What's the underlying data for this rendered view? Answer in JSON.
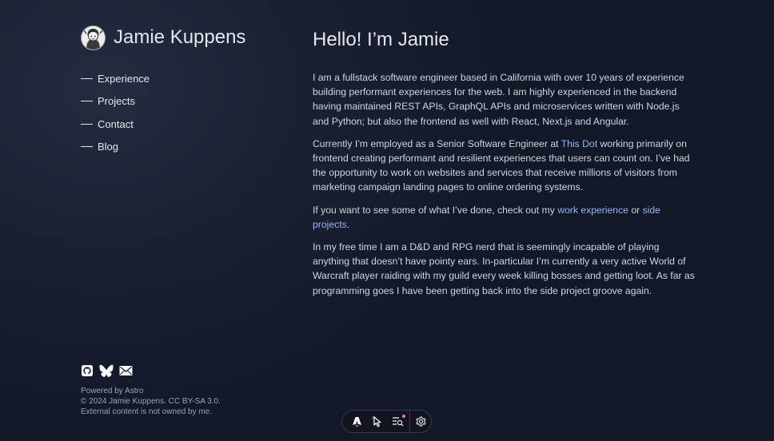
{
  "sidebar": {
    "site_name": "Jamie Kuppens",
    "avatar_icon": "avatar-illustration",
    "nav": [
      {
        "label": "Experience"
      },
      {
        "label": "Projects"
      },
      {
        "label": "Contact"
      },
      {
        "label": "Blog"
      }
    ],
    "social": [
      {
        "icon": "github-icon"
      },
      {
        "icon": "bluesky-icon"
      },
      {
        "icon": "mail-icon"
      }
    ],
    "footer": {
      "powered": "Powered by Astro",
      "copyright": "© 2024 Jamie Kuppens. CC BY-SA 3.0.",
      "disclaimer": "External content is not owned by me."
    }
  },
  "main": {
    "title": "Hello! I’m Jamie",
    "p1": "I am a fullstack software engineer based in California with over 10 years of experience building performant experiences for the web. I am highly experienced in the backend having maintained REST APIs, GraphQL APIs and microservices written with Node.js and Python; but also the frontend as well with React, Next.js and Angular.",
    "p2_before": "Currently I’m employed as a Senior Software Engineer at ",
    "p2_link": "This Dot",
    "p2_after": " working primarily on frontend creating performant and resilient experiences that users can count on. I’ve had the opportunity to work on websites and services that receive millions of visitors from marketing campaign landing pages to online ordering systems.",
    "p3_before": "If you want to see some of what I’ve done, check out my ",
    "p3_link1": "work experience",
    "p3_mid": " or ",
    "p3_link2": "side projects",
    "p3_after": ".",
    "p4": "In my free time I am a D&D and RPG nerd that is seemingly incapable of playing anything that doesn’t have pointy ears. In-particular I’m currently a very active World of Warcraft player raiding with my guild every week killing bosses and getting loot. As far as programming goes I have been getting back into the side project groove again."
  },
  "toolbar": {
    "icons": [
      "astro-logo-icon",
      "inspect-cursor-icon",
      "audit-list-icon",
      "settings-gear-icon"
    ],
    "notification_color": "#f472b6"
  },
  "colors": {
    "background": "#1b2133",
    "text": "#d1d5db",
    "heading": "#e5e7eb",
    "link": "#93b4f5",
    "muted": "#9ca3af"
  }
}
